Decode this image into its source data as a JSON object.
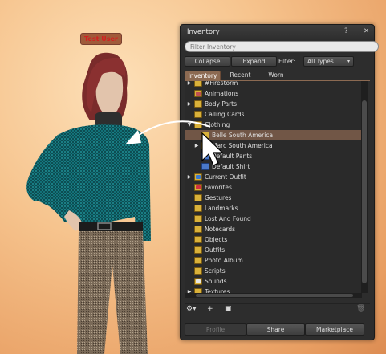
{
  "scene": {
    "avatar_name": "Test User"
  },
  "inventory": {
    "title": "Inventory",
    "title_buttons": [
      "?",
      "−",
      "✕"
    ],
    "filter_placeholder": "Filter Inventory",
    "collapse_label": "Collapse",
    "expand_label": "Expand",
    "filter_label": "Filter:",
    "filter_value": "All Types",
    "tabs": [
      "Inventory",
      "Recent",
      "Worn"
    ],
    "active_tab": "Inventory",
    "items": [
      {
        "label": "#Firestorm",
        "icon": "folder-icon",
        "expandable": true
      },
      {
        "label": "Animations",
        "icon": "animation-folder-icon",
        "expandable": false
      },
      {
        "label": "Body Parts",
        "icon": "bodypart-folder-icon",
        "expandable": true
      },
      {
        "label": "Calling Cards",
        "icon": "callingcard-folder-icon",
        "expandable": false
      },
      {
        "label": "Clothing",
        "icon": "clothing-folder-icon",
        "expandable": true,
        "expanded": true
      },
      {
        "label": "Belle South America",
        "icon": "folder-icon",
        "indent": 1,
        "selected": true
      },
      {
        "label": "Marc South America",
        "icon": "folder-icon",
        "indent": 1,
        "expandable": true
      },
      {
        "label": "Default Pants",
        "icon": "pants-icon",
        "indent": 1
      },
      {
        "label": "Default Shirt",
        "icon": "shirt-icon",
        "indent": 1
      },
      {
        "label": "Current Outfit",
        "icon": "outfit-folder-icon",
        "expandable": true
      },
      {
        "label": "Favorites",
        "icon": "favorites-folder-icon"
      },
      {
        "label": "Gestures",
        "icon": "gesture-folder-icon"
      },
      {
        "label": "Landmarks",
        "icon": "landmark-folder-icon"
      },
      {
        "label": "Lost And Found",
        "icon": "lostfound-folder-icon"
      },
      {
        "label": "Notecards",
        "icon": "notecard-folder-icon"
      },
      {
        "label": "Objects",
        "icon": "object-folder-icon"
      },
      {
        "label": "Outfits",
        "icon": "outfits-folder-icon"
      },
      {
        "label": "Photo Album",
        "icon": "photo-folder-icon"
      },
      {
        "label": "Scripts",
        "icon": "script-folder-icon"
      },
      {
        "label": "Sounds",
        "icon": "sound-folder-icon"
      },
      {
        "label": "Textures",
        "icon": "texture-folder-icon",
        "expandable": true
      }
    ],
    "bottom_icons": [
      "gear-dropdown-icon",
      "plus-icon",
      "panel-icon",
      "trash-icon"
    ],
    "footer_buttons": [
      "Profile",
      "Share",
      "Marketplace"
    ]
  },
  "colors": {
    "panel_bg": "#2d2d2d",
    "selection": "#715646",
    "tab_active": "#8c6a52",
    "folder": "#d9b13a",
    "name_tag_text": "#d42020"
  }
}
